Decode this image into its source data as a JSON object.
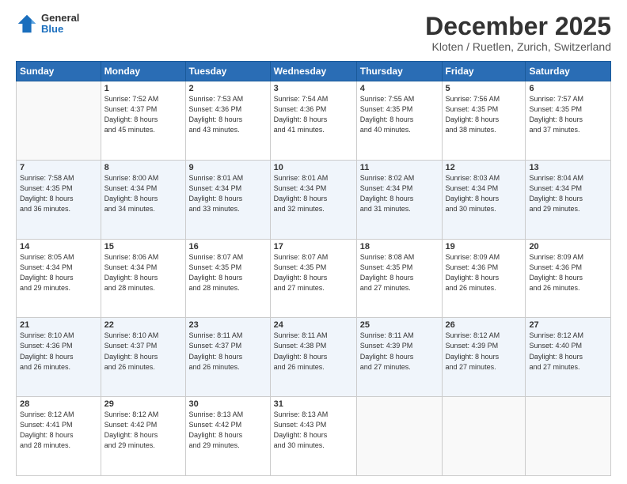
{
  "header": {
    "logo_general": "General",
    "logo_blue": "Blue",
    "month_title": "December 2025",
    "location": "Kloten / Ruetlen, Zurich, Switzerland"
  },
  "weekdays": [
    "Sunday",
    "Monday",
    "Tuesday",
    "Wednesday",
    "Thursday",
    "Friday",
    "Saturday"
  ],
  "weeks": [
    [
      {
        "day": "",
        "info": ""
      },
      {
        "day": "1",
        "info": "Sunrise: 7:52 AM\nSunset: 4:37 PM\nDaylight: 8 hours\nand 45 minutes."
      },
      {
        "day": "2",
        "info": "Sunrise: 7:53 AM\nSunset: 4:36 PM\nDaylight: 8 hours\nand 43 minutes."
      },
      {
        "day": "3",
        "info": "Sunrise: 7:54 AM\nSunset: 4:36 PM\nDaylight: 8 hours\nand 41 minutes."
      },
      {
        "day": "4",
        "info": "Sunrise: 7:55 AM\nSunset: 4:35 PM\nDaylight: 8 hours\nand 40 minutes."
      },
      {
        "day": "5",
        "info": "Sunrise: 7:56 AM\nSunset: 4:35 PM\nDaylight: 8 hours\nand 38 minutes."
      },
      {
        "day": "6",
        "info": "Sunrise: 7:57 AM\nSunset: 4:35 PM\nDaylight: 8 hours\nand 37 minutes."
      }
    ],
    [
      {
        "day": "7",
        "info": "Sunrise: 7:58 AM\nSunset: 4:35 PM\nDaylight: 8 hours\nand 36 minutes."
      },
      {
        "day": "8",
        "info": "Sunrise: 8:00 AM\nSunset: 4:34 PM\nDaylight: 8 hours\nand 34 minutes."
      },
      {
        "day": "9",
        "info": "Sunrise: 8:01 AM\nSunset: 4:34 PM\nDaylight: 8 hours\nand 33 minutes."
      },
      {
        "day": "10",
        "info": "Sunrise: 8:01 AM\nSunset: 4:34 PM\nDaylight: 8 hours\nand 32 minutes."
      },
      {
        "day": "11",
        "info": "Sunrise: 8:02 AM\nSunset: 4:34 PM\nDaylight: 8 hours\nand 31 minutes."
      },
      {
        "day": "12",
        "info": "Sunrise: 8:03 AM\nSunset: 4:34 PM\nDaylight: 8 hours\nand 30 minutes."
      },
      {
        "day": "13",
        "info": "Sunrise: 8:04 AM\nSunset: 4:34 PM\nDaylight: 8 hours\nand 29 minutes."
      }
    ],
    [
      {
        "day": "14",
        "info": "Sunrise: 8:05 AM\nSunset: 4:34 PM\nDaylight: 8 hours\nand 29 minutes."
      },
      {
        "day": "15",
        "info": "Sunrise: 8:06 AM\nSunset: 4:34 PM\nDaylight: 8 hours\nand 28 minutes."
      },
      {
        "day": "16",
        "info": "Sunrise: 8:07 AM\nSunset: 4:35 PM\nDaylight: 8 hours\nand 28 minutes."
      },
      {
        "day": "17",
        "info": "Sunrise: 8:07 AM\nSunset: 4:35 PM\nDaylight: 8 hours\nand 27 minutes."
      },
      {
        "day": "18",
        "info": "Sunrise: 8:08 AM\nSunset: 4:35 PM\nDaylight: 8 hours\nand 27 minutes."
      },
      {
        "day": "19",
        "info": "Sunrise: 8:09 AM\nSunset: 4:36 PM\nDaylight: 8 hours\nand 26 minutes."
      },
      {
        "day": "20",
        "info": "Sunrise: 8:09 AM\nSunset: 4:36 PM\nDaylight: 8 hours\nand 26 minutes."
      }
    ],
    [
      {
        "day": "21",
        "info": "Sunrise: 8:10 AM\nSunset: 4:36 PM\nDaylight: 8 hours\nand 26 minutes."
      },
      {
        "day": "22",
        "info": "Sunrise: 8:10 AM\nSunset: 4:37 PM\nDaylight: 8 hours\nand 26 minutes."
      },
      {
        "day": "23",
        "info": "Sunrise: 8:11 AM\nSunset: 4:37 PM\nDaylight: 8 hours\nand 26 minutes."
      },
      {
        "day": "24",
        "info": "Sunrise: 8:11 AM\nSunset: 4:38 PM\nDaylight: 8 hours\nand 26 minutes."
      },
      {
        "day": "25",
        "info": "Sunrise: 8:11 AM\nSunset: 4:39 PM\nDaylight: 8 hours\nand 27 minutes."
      },
      {
        "day": "26",
        "info": "Sunrise: 8:12 AM\nSunset: 4:39 PM\nDaylight: 8 hours\nand 27 minutes."
      },
      {
        "day": "27",
        "info": "Sunrise: 8:12 AM\nSunset: 4:40 PM\nDaylight: 8 hours\nand 27 minutes."
      }
    ],
    [
      {
        "day": "28",
        "info": "Sunrise: 8:12 AM\nSunset: 4:41 PM\nDaylight: 8 hours\nand 28 minutes."
      },
      {
        "day": "29",
        "info": "Sunrise: 8:12 AM\nSunset: 4:42 PM\nDaylight: 8 hours\nand 29 minutes."
      },
      {
        "day": "30",
        "info": "Sunrise: 8:13 AM\nSunset: 4:42 PM\nDaylight: 8 hours\nand 29 minutes."
      },
      {
        "day": "31",
        "info": "Sunrise: 8:13 AM\nSunset: 4:43 PM\nDaylight: 8 hours\nand 30 minutes."
      },
      {
        "day": "",
        "info": ""
      },
      {
        "day": "",
        "info": ""
      },
      {
        "day": "",
        "info": ""
      }
    ]
  ]
}
